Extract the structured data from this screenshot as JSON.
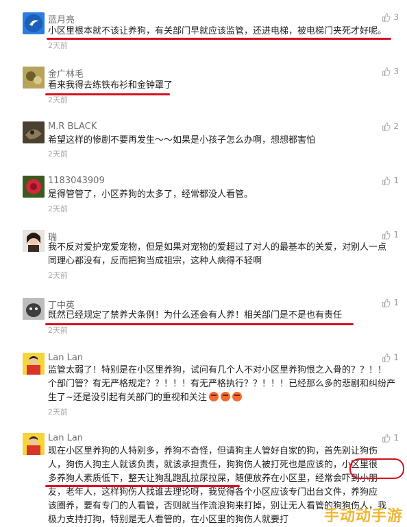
{
  "comments": [
    {
      "user": "蓝月亮",
      "likes": "3",
      "lines": [
        "小区里根本就不该让养狗，有关部门早就应该监管，还进电梯，被电梯门夹死才好呢。"
      ],
      "time": "2天前",
      "avatar_color": "#2a7de1"
    },
    {
      "user": "金广林毛",
      "likes": "3",
      "lines": [
        "看来我得去练铁布衫和金钟罩了"
      ],
      "time": "2天前",
      "avatar_color": "#8a7a3a"
    },
    {
      "user": "M.R BLACK",
      "likes": "2",
      "lines": [
        "希望这样的惨剧不要再发生～～如果是小孩子怎么办啊，想想都害怕"
      ],
      "time": "2天前",
      "avatar_color": "#5a5040"
    },
    {
      "user": "1183043909",
      "likes": "1",
      "lines": [
        "是得管管了，小区养狗的太多了，经常都没人看管。"
      ],
      "time": "2天前",
      "avatar_color": "#c2283a"
    },
    {
      "user": "瑞",
      "likes": "1",
      "lines": [
        "我不反对爱护宠爱宠物，但是如果对宠物的爱超过了对人的最基本的关爱，对别人一点",
        "同理心都没有，反而把狗当成祖宗，这种人病得不轻啊"
      ],
      "time": "2天前",
      "avatar_color": "#3a2a22"
    },
    {
      "user": "丁中英",
      "likes": "1",
      "lines": [
        "既然已经规定了禁养犬条例！为什么还会有人养！相关部门是不是也有责任"
      ],
      "time": "2天前",
      "avatar_color": "#6a6a6a"
    },
    {
      "user": "Lan Lan",
      "likes": "1",
      "lines": [
        "监管太弱了！特别是在小区里养狗，试问有几个人不对小区里养狗恨之入骨的？？！！",
        "个部门管？有无严格规定？？！！！有无严格执行？？！！！已经那么多的悲剧和纠纷产",
        "生了~还是没引起有关部门的重视和关注"
      ],
      "time": "2天前",
      "avatar_color": "#d8342a"
    },
    {
      "user": "Lan Lan",
      "likes": "1",
      "lines": [
        "现在小区里养狗的人特别多，养狗不奇怪，但请狗主人管好自家的狗，首先别让狗伤",
        "人，狗伤人狗主人就该负责，就该承担责任，狗狗伤人被打死也是应该的，小区里很",
        "多养狗人素质低下，整天让狗乱跑乱拉尿拉屎，随便放养在小区里，经常会吓到小朋",
        "友，老年人，这样狗伤人找谁去理论呀，我觉得各个小区应该专门出台文件，养狗应",
        "该圈养，要有专门的人看管，否则就当作流浪狗来打掉，别让无人看管的狗狗伤人，我",
        "极力支持打狗，特别是无人看管的，在小区里的狗伤人就要打"
      ],
      "time": "",
      "avatar_color": "#d8342a"
    }
  ],
  "watermark": "手动动手游",
  "colors": {
    "highlight": "#d40f1b",
    "meta": "#aaaaaa",
    "username": "#6d6d6d"
  }
}
